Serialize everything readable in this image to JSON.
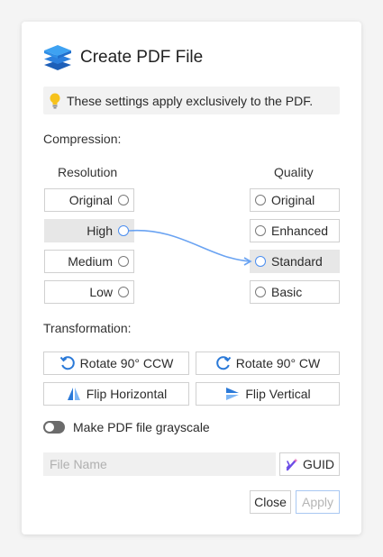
{
  "dialog": {
    "title": "Create PDF File",
    "note": "These settings apply exclusively to the PDF."
  },
  "compression": {
    "label": "Compression:",
    "resolution_header": "Resolution",
    "quality_header": "Quality",
    "resolution_options": [
      "Original",
      "High",
      "Medium",
      "Low"
    ],
    "quality_options": [
      "Original",
      "Enhanced",
      "Standard",
      "Basic"
    ],
    "selected_resolution": "High",
    "selected_quality": "Standard"
  },
  "transformation": {
    "label": "Transformation:",
    "rotate_ccw": "Rotate 90° CCW",
    "rotate_cw": "Rotate 90° CW",
    "flip_horizontal": "Flip Horizontal",
    "flip_vertical": "Flip Vertical"
  },
  "grayscale": {
    "label": "Make PDF file grayscale",
    "enabled": false
  },
  "filename": {
    "placeholder": "File Name",
    "value": ""
  },
  "guid_label": "GUID",
  "footer": {
    "close_label": "Close",
    "apply_label": "Apply"
  },
  "colors": {
    "accent": "#4b8ef0",
    "logo_blue": "#2a79d8"
  }
}
